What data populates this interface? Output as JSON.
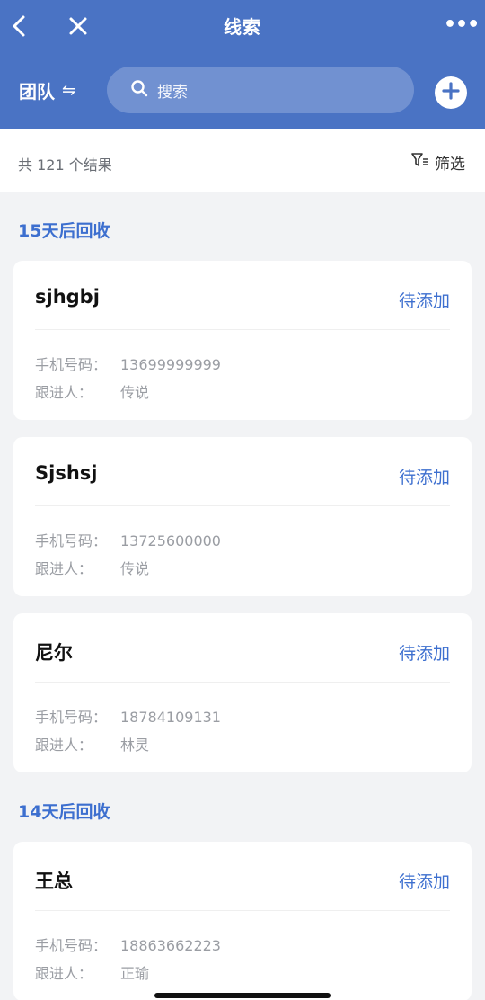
{
  "colors": {
    "header_bg": "#4a73c4",
    "accent": "#3d6fcf",
    "page_bg": "#f2f3f5"
  },
  "nav": {
    "title": "线索",
    "back_icon": "chevron-left-icon",
    "close_icon": "close-icon",
    "more_icon": "more-dots-icon"
  },
  "toolbar": {
    "team_label": "团队",
    "swap_icon": "swap-icon",
    "search_placeholder": "搜索",
    "add_icon": "plus-icon"
  },
  "results": {
    "count_text": "共 121 个结果",
    "filter_label": "筛选",
    "filter_icon": "filter-icon"
  },
  "groups": [
    {
      "title": "15天后回收",
      "cards": [
        {
          "name": "sjhgbj",
          "status": "待添加",
          "phone_label": "手机号码：",
          "phone": "13699999999",
          "owner_label": "跟进人：",
          "owner": "传说"
        },
        {
          "name": "Sjshsj",
          "status": "待添加",
          "phone_label": "手机号码：",
          "phone": "13725600000",
          "owner_label": "跟进人：",
          "owner": "传说"
        },
        {
          "name": "尼尔",
          "status": "待添加",
          "phone_label": "手机号码：",
          "phone": "18784109131",
          "owner_label": "跟进人：",
          "owner": "林灵"
        }
      ]
    },
    {
      "title": "14天后回收",
      "cards": [
        {
          "name": "王总",
          "status": "待添加",
          "phone_label": "手机号码：",
          "phone": "18863662223",
          "owner_label": "跟进人：",
          "owner": "正瑜"
        }
      ]
    }
  ]
}
